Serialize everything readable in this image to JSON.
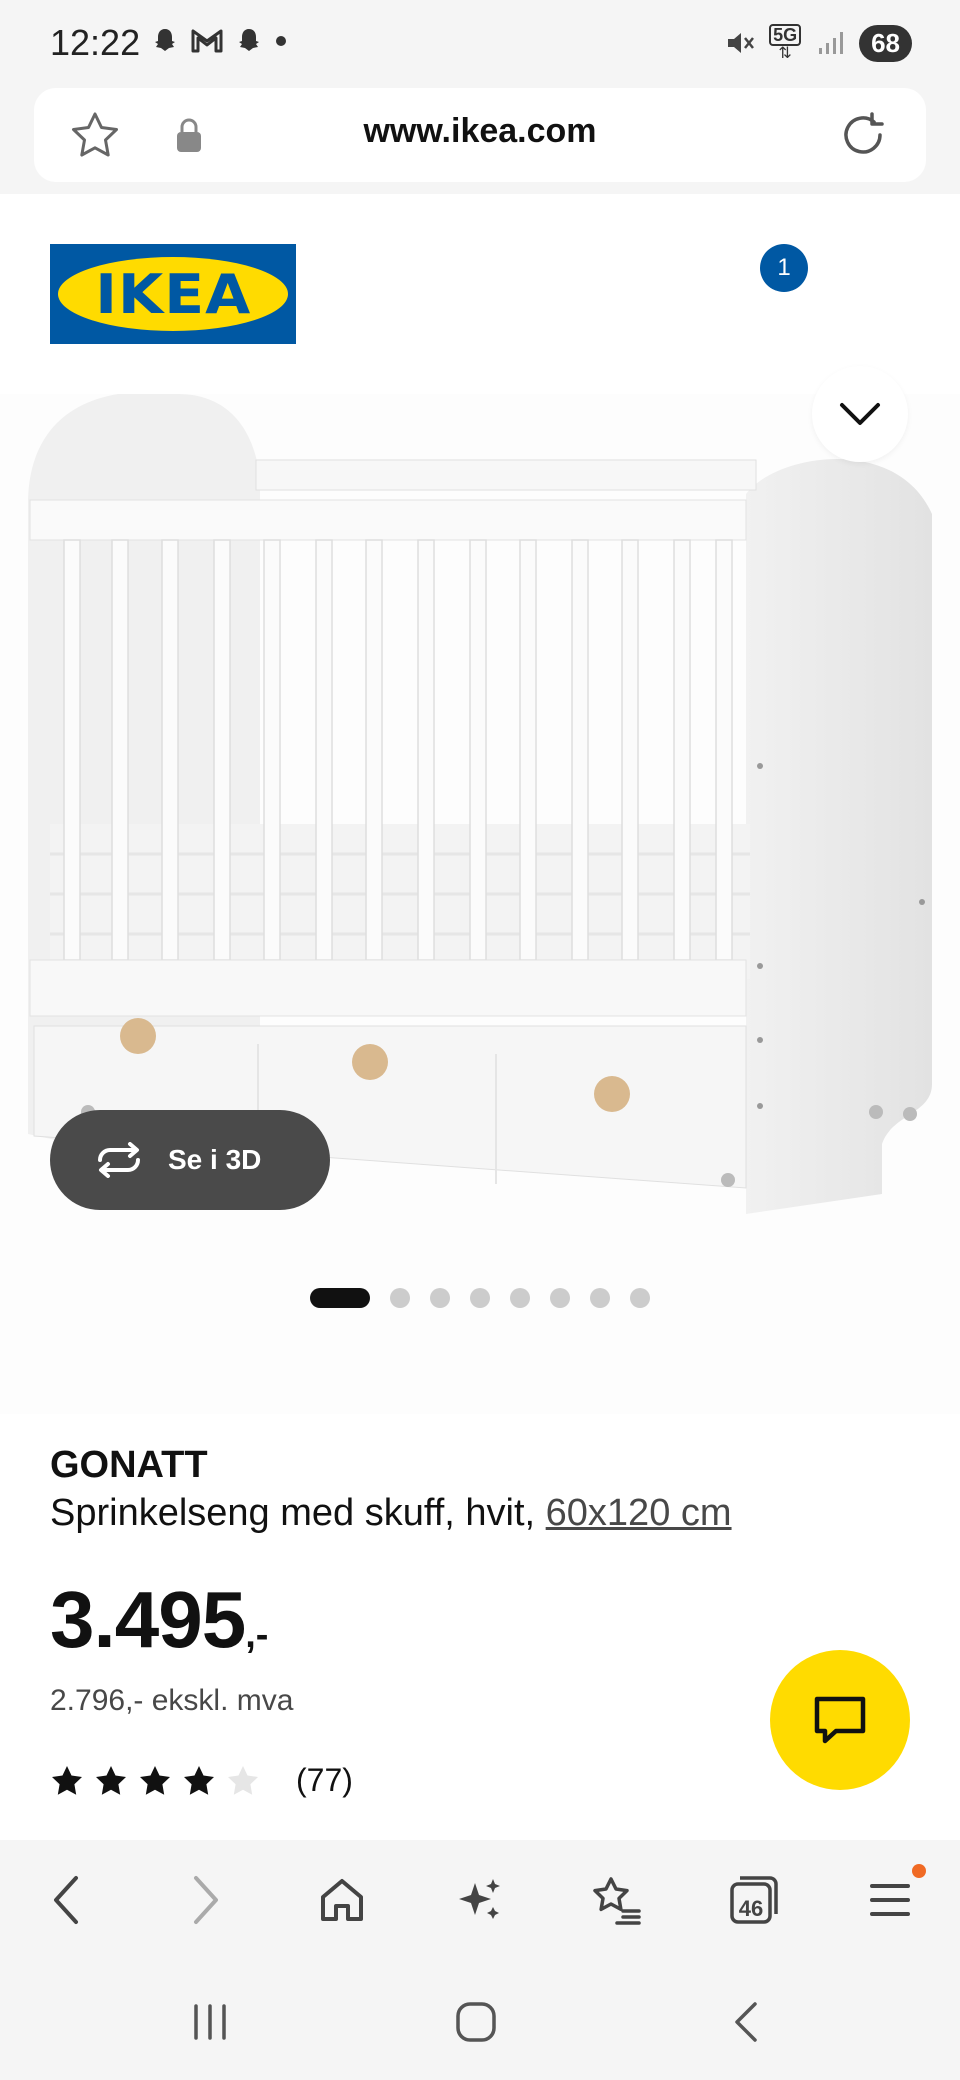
{
  "status_bar": {
    "time": "12:22",
    "network": "5G",
    "battery": "68"
  },
  "browser": {
    "url": "www.ikea.com",
    "tabs_count": "46"
  },
  "header": {
    "logo_text": "IKEA",
    "cart_count": "1"
  },
  "gallery": {
    "view_3d_label": "Se i 3D",
    "image_count": 8,
    "active_index": 0
  },
  "product": {
    "name": "GONATT",
    "description": "Sprinkelseng med skuff, hvit,",
    "size_link": "60x120 cm",
    "price_main": "3.495",
    "price_suffix": ",-",
    "price_excl_vat": "2.796,- ekskl. mva",
    "rating": 4,
    "rating_max": 5,
    "review_count": "(77)"
  },
  "colors": {
    "ikea_blue": "#0058a3",
    "ikea_yellow": "#ffdb00",
    "notification_orange": "#f06a24"
  }
}
